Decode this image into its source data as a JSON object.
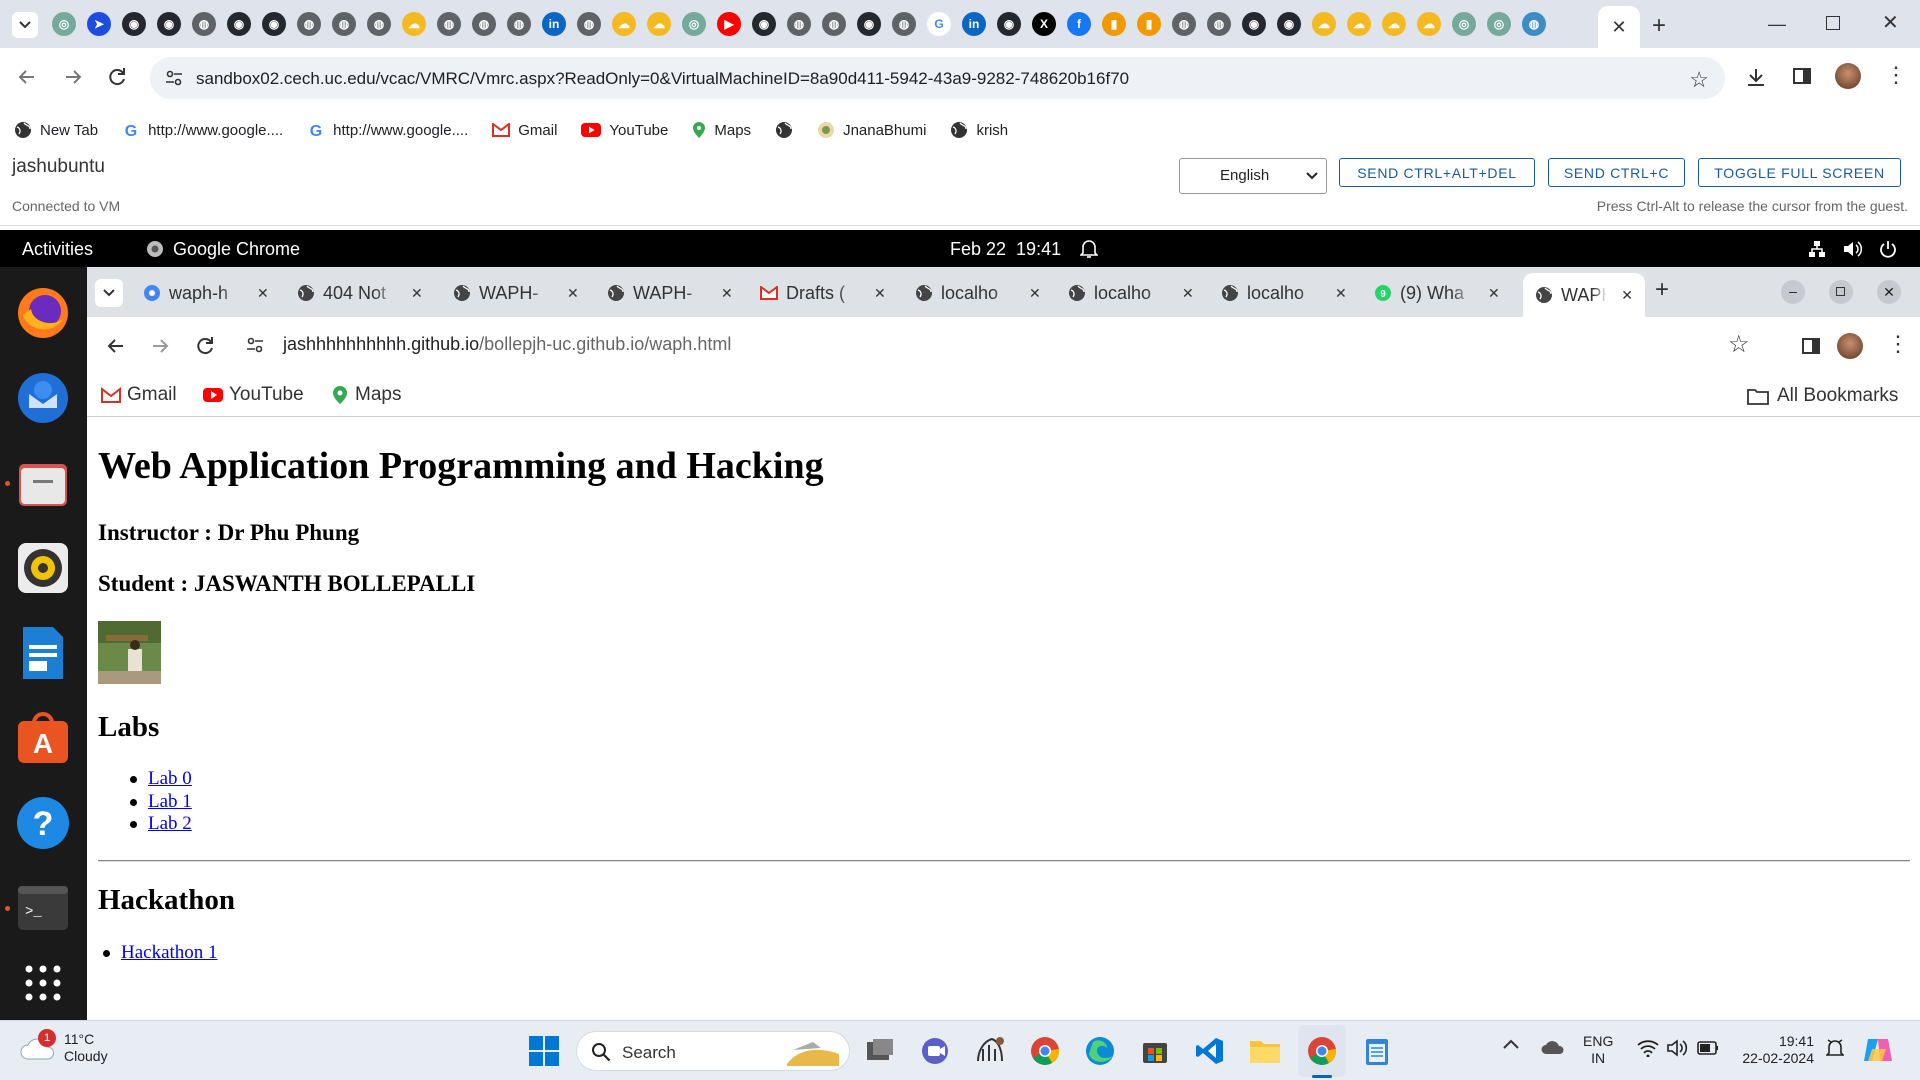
{
  "host_browser": {
    "url_host": "sandbox02.cech.uc.edu",
    "url_path": "/vcac/VMRC/Vmrc.aspx?ReadOnly=0&VirtualMachineID=8a90d411-5942-43a9-9282-748620b16f70",
    "bookmarks": [
      {
        "label": "New Tab",
        "icon": "globe-icon"
      },
      {
        "label": "http://www.google....",
        "icon": "google-icon"
      },
      {
        "label": "http://www.google....",
        "icon": "google-icon"
      },
      {
        "label": "Gmail",
        "icon": "gmail-icon"
      },
      {
        "label": "YouTube",
        "icon": "youtube-icon"
      },
      {
        "label": "Maps",
        "icon": "maps-icon"
      },
      {
        "label": "",
        "icon": "globe-icon"
      },
      {
        "label": "JnanaBhumi",
        "icon": "jnanabhumi-icon"
      },
      {
        "label": "krish",
        "icon": "globe-icon"
      }
    ],
    "pinned_tab_icons": [
      "chatgpt",
      "arrow",
      "github",
      "github",
      "globe",
      "github",
      "github",
      "globe",
      "globe",
      "globe",
      "weather",
      "globe",
      "globe",
      "globe",
      "linkedin",
      "globe",
      "weather",
      "weather",
      "chatgpt",
      "youtube",
      "github",
      "globe",
      "globe",
      "github",
      "globe",
      "google",
      "linkedin",
      "github",
      "x",
      "facebook",
      "chart",
      "chart",
      "globe",
      "globe",
      "github",
      "github",
      "weather",
      "weather",
      "weather",
      "weather",
      "chatgpt",
      "chatgpt",
      "earth"
    ]
  },
  "vmrc": {
    "vm_name": "jashubuntu",
    "status": "Connected to VM",
    "language": "English",
    "buttons": {
      "ctrl_alt_del": "SEND CTRL+ALT+DEL",
      "ctrl_c": "SEND CTRL+C",
      "full_screen": "TOGGLE FULL SCREEN"
    },
    "hint": "Press Ctrl-Alt to release the cursor from the guest."
  },
  "ubuntu": {
    "activities": "Activities",
    "app_name": "Google Chrome",
    "clock": "Feb 22  19:41"
  },
  "guest_browser": {
    "tabs": [
      {
        "title": "waph-h",
        "icon": "chrome-icon"
      },
      {
        "title": "404 Not",
        "icon": "globe-icon"
      },
      {
        "title": "WAPH-",
        "icon": "globe-icon"
      },
      {
        "title": "WAPH-",
        "icon": "globe-icon"
      },
      {
        "title": "Drafts (",
        "icon": "gmail-icon"
      },
      {
        "title": "localho",
        "icon": "globe-icon"
      },
      {
        "title": "localho",
        "icon": "globe-icon"
      },
      {
        "title": "localho",
        "icon": "globe-icon"
      },
      {
        "title": "(9) Wha",
        "icon": "whatsapp-icon"
      },
      {
        "title": "WAPH-",
        "icon": "globe-icon"
      }
    ],
    "url_host": "jashhhhhhhhhh.github.io",
    "url_path": "/bollepjh-uc.github.io/waph.html",
    "bookmarks": [
      "Gmail",
      "YouTube",
      "Maps"
    ],
    "all_bookmarks": "All Bookmarks"
  },
  "page": {
    "title": "Web Application Programming and Hacking",
    "instructor": "Instructor : Dr Phu Phung",
    "student": "Student : JASWANTH BOLLEPALLI",
    "labs_heading": "Labs",
    "labs": [
      "Lab 0",
      "Lab 1",
      "Lab 2"
    ],
    "hackathon_heading": "Hackathon",
    "hackathons": [
      "Hackathon 1"
    ]
  },
  "taskbar": {
    "weather_temp": "11°C",
    "weather_desc": "Cloudy",
    "weather_badge": "1",
    "search_placeholder": "Search",
    "lang_top": "ENG",
    "lang_bottom": "IN",
    "time": "19:41",
    "date": "22-02-2024"
  },
  "colors": {
    "link": "#0000ee",
    "vmrc_button": "#1a5aa0",
    "host_tabstrip": "#dfe3eb"
  }
}
